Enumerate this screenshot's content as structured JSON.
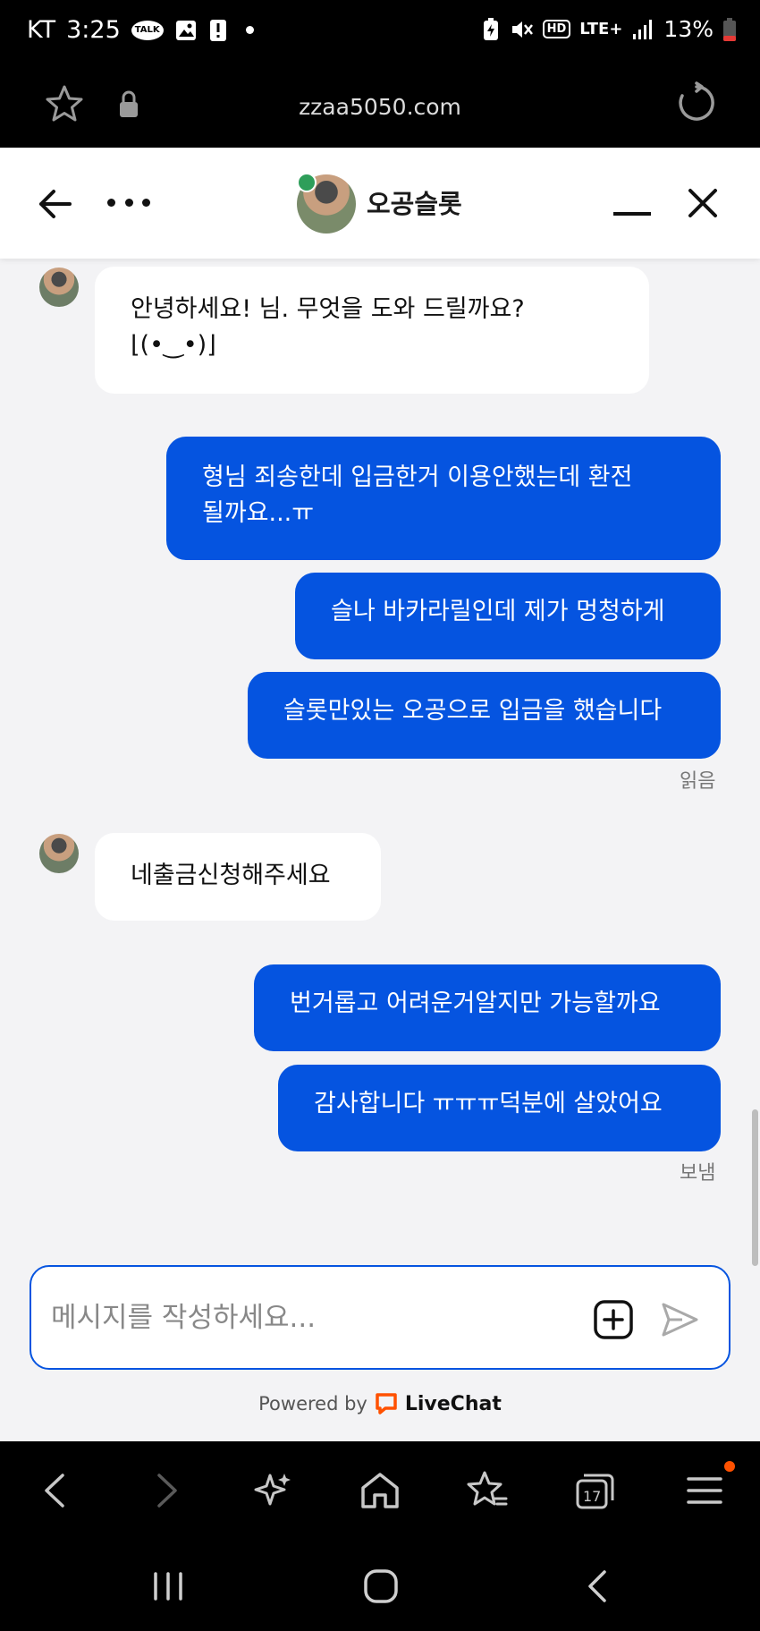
{
  "status_bar": {
    "carrier": "KT",
    "time": "3:25",
    "talk_badge": "TALK",
    "network": "LTE+",
    "battery": "13%"
  },
  "browser": {
    "url": "zzaa5050.com"
  },
  "chat": {
    "agent_name": "오공슬롯",
    "messages": [
      {
        "from": "agent",
        "lines": [
          "안녕하세요! 님. 무엇을 도와 드릴까요?",
          "⌊(•‿•)⌋"
        ]
      },
      {
        "from": "user",
        "lines": [
          "형님 죄송한데 입금한거 이용안했는데 환전",
          "될까요...ㅠ"
        ]
      },
      {
        "from": "user",
        "lines": [
          "슬나 바카라릴인데 제가 멍청하게"
        ]
      },
      {
        "from": "user",
        "lines": [
          "슬롯만있는 오공으로 입금을 했습니다"
        ]
      },
      {
        "from": "agent",
        "lines": [
          "네출금신청해주세요"
        ]
      },
      {
        "from": "user",
        "lines": [
          "번거롭고 어려운거알지만 가능할까요"
        ]
      },
      {
        "from": "user",
        "lines": [
          "감사합니다 ㅠㅠㅠ덕분에 살았어요"
        ]
      }
    ],
    "read_label": "읽음",
    "sent_label": "보냄",
    "composer_placeholder": "메시지를 작성하세요...",
    "powered_by": "Powered by",
    "brand": "LiveChat"
  },
  "toolbar": {
    "tabs_count": "17"
  },
  "colors": {
    "user_bubble": "#0554e0",
    "agent_bubble": "#ffffff",
    "chat_bg": "#f3f3f5",
    "brand_orange": "#ff5100",
    "online": "#2e9e5a"
  }
}
